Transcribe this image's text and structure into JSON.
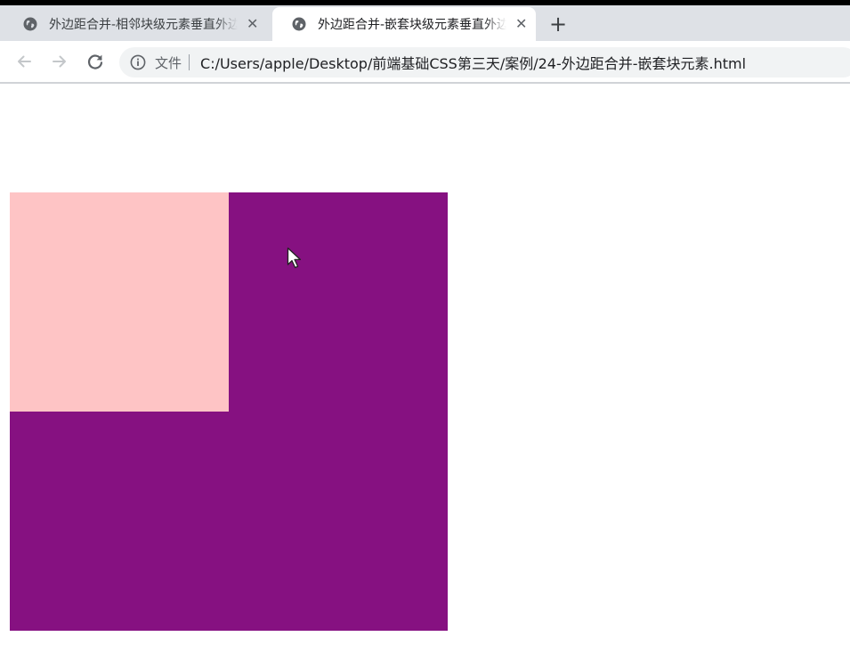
{
  "browser": {
    "tabs": [
      {
        "title": "外边距合并-相邻块级元素垂直外边距合并",
        "active": false,
        "icon": "globe-icon"
      },
      {
        "title": "外边距合并-嵌套块级元素垂直外边距合并",
        "active": true,
        "icon": "globe-icon"
      }
    ],
    "close_glyph": "✕",
    "new_tab_glyph": "+",
    "address_bar": {
      "security_label": "文件",
      "url": "C:/Users/apple/Desktop/前端基础CSS第三天/案例/24-外边距合并-嵌套块元素.html"
    }
  },
  "page": {
    "colors": {
      "outer_box": "#861181",
      "inner_box": "#fec4c5"
    }
  }
}
